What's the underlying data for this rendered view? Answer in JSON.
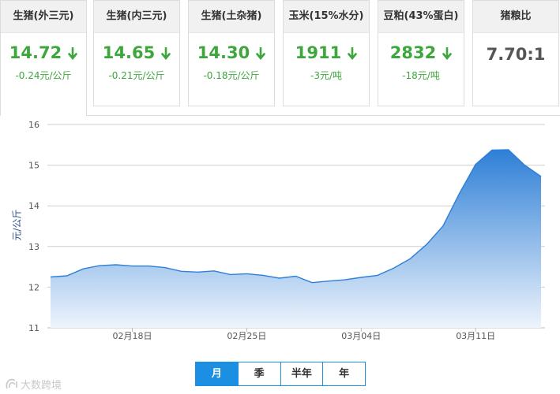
{
  "cards": [
    {
      "title": "生猪(外三元)",
      "value": "14.72",
      "change": "-0.24元/公斤",
      "trend": "down"
    },
    {
      "title": "生猪(内三元)",
      "value": "14.65",
      "change": "-0.21元/公斤",
      "trend": "down"
    },
    {
      "title": "生猪(土杂猪)",
      "value": "14.30",
      "change": "-0.18元/公斤",
      "trend": "down"
    },
    {
      "title": "玉米(15%水分)",
      "value": "1911",
      "change": "-3元/吨",
      "trend": "down"
    },
    {
      "title": "豆粕(43%蛋白)",
      "value": "2832",
      "change": "-18元/吨",
      "trend": "down"
    },
    {
      "title": "猪粮比",
      "value": "7.70:1"
    }
  ],
  "colors": {
    "down": "#3da63d",
    "accent": "#1d8fe3",
    "line": "#2d7fd8",
    "fill_top": "#2e7fd6",
    "fill_bottom": "#eef4fc",
    "grid": "#cfcfcf"
  },
  "chart_data": {
    "type": "area",
    "ylabel": "元/公斤",
    "ylim": [
      11,
      16
    ],
    "yticks": [
      "16",
      "15",
      "14",
      "13",
      "12",
      "11"
    ],
    "xticks": [
      "02月18日",
      "02月25日",
      "03月04日",
      "03月11日"
    ],
    "xtick_index": [
      5,
      12,
      19,
      26
    ],
    "values": [
      12.25,
      12.28,
      12.45,
      12.53,
      12.55,
      12.52,
      12.52,
      12.48,
      12.39,
      12.37,
      12.4,
      12.31,
      12.33,
      12.29,
      12.22,
      12.27,
      12.11,
      12.15,
      12.18,
      12.24,
      12.29,
      12.47,
      12.7,
      13.05,
      13.5,
      14.3,
      15.02,
      15.37,
      15.38,
      15.0,
      14.72
    ]
  },
  "range_buttons": [
    {
      "label": "月",
      "active": true
    },
    {
      "label": "季",
      "active": false
    },
    {
      "label": "半年",
      "active": false
    },
    {
      "label": "年",
      "active": false
    }
  ],
  "watermark": "大数跨境"
}
